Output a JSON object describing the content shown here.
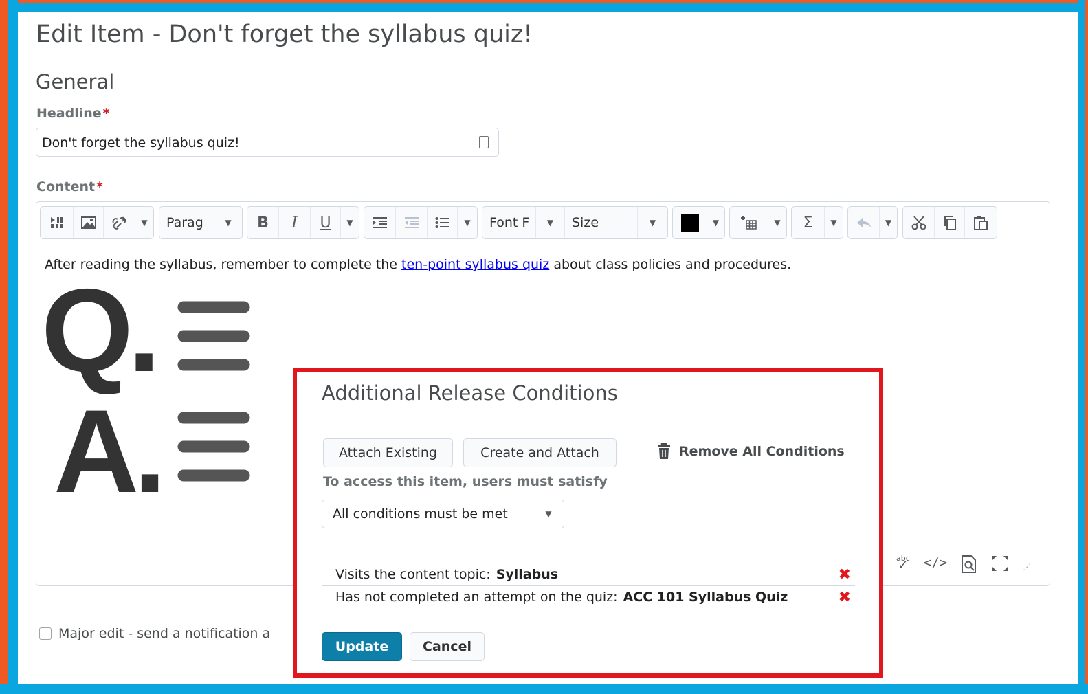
{
  "page": {
    "title": "Edit Item - Don't forget the syllabus quiz!",
    "section": "General"
  },
  "form": {
    "headline_label": "Headline",
    "headline_value": "Don't forget the syllabus quiz!",
    "content_label": "Content",
    "required_mark": "*",
    "major_edit_label": "Major edit - send a notification a"
  },
  "toolbar": {
    "format_value": "Parag",
    "font_value": "Font F",
    "size_value": "Size",
    "text_color": "#000000"
  },
  "editor": {
    "text_before": "After reading the syllabus, remember to complete the ",
    "link_text": "ten-point syllabus quiz",
    "text_after": " about class policies and procedures.",
    "spellcheck_label": "abc"
  },
  "qa_art": {
    "q_letter": "Q.",
    "a_letter": "A."
  },
  "release": {
    "title": "Additional Release Conditions",
    "attach_existing": "Attach Existing",
    "create_attach": "Create and Attach",
    "remove_all": "Remove All Conditions",
    "access_label": "To access this item, users must satisfy",
    "condition_mode": "All conditions must be met",
    "conditions": [
      {
        "text": "Visits the content topic:",
        "target": "Syllabus"
      },
      {
        "text": "Has not completed an attempt on the quiz:",
        "target": "ACC 101 Syllabus Quiz"
      }
    ],
    "update": "Update",
    "cancel": "Cancel"
  },
  "colors": {
    "frame_orange": "#ef5a24",
    "frame_blue": "#0aa6df",
    "highlight_red": "#e0171f",
    "primary_button": "#0e7fa9"
  }
}
